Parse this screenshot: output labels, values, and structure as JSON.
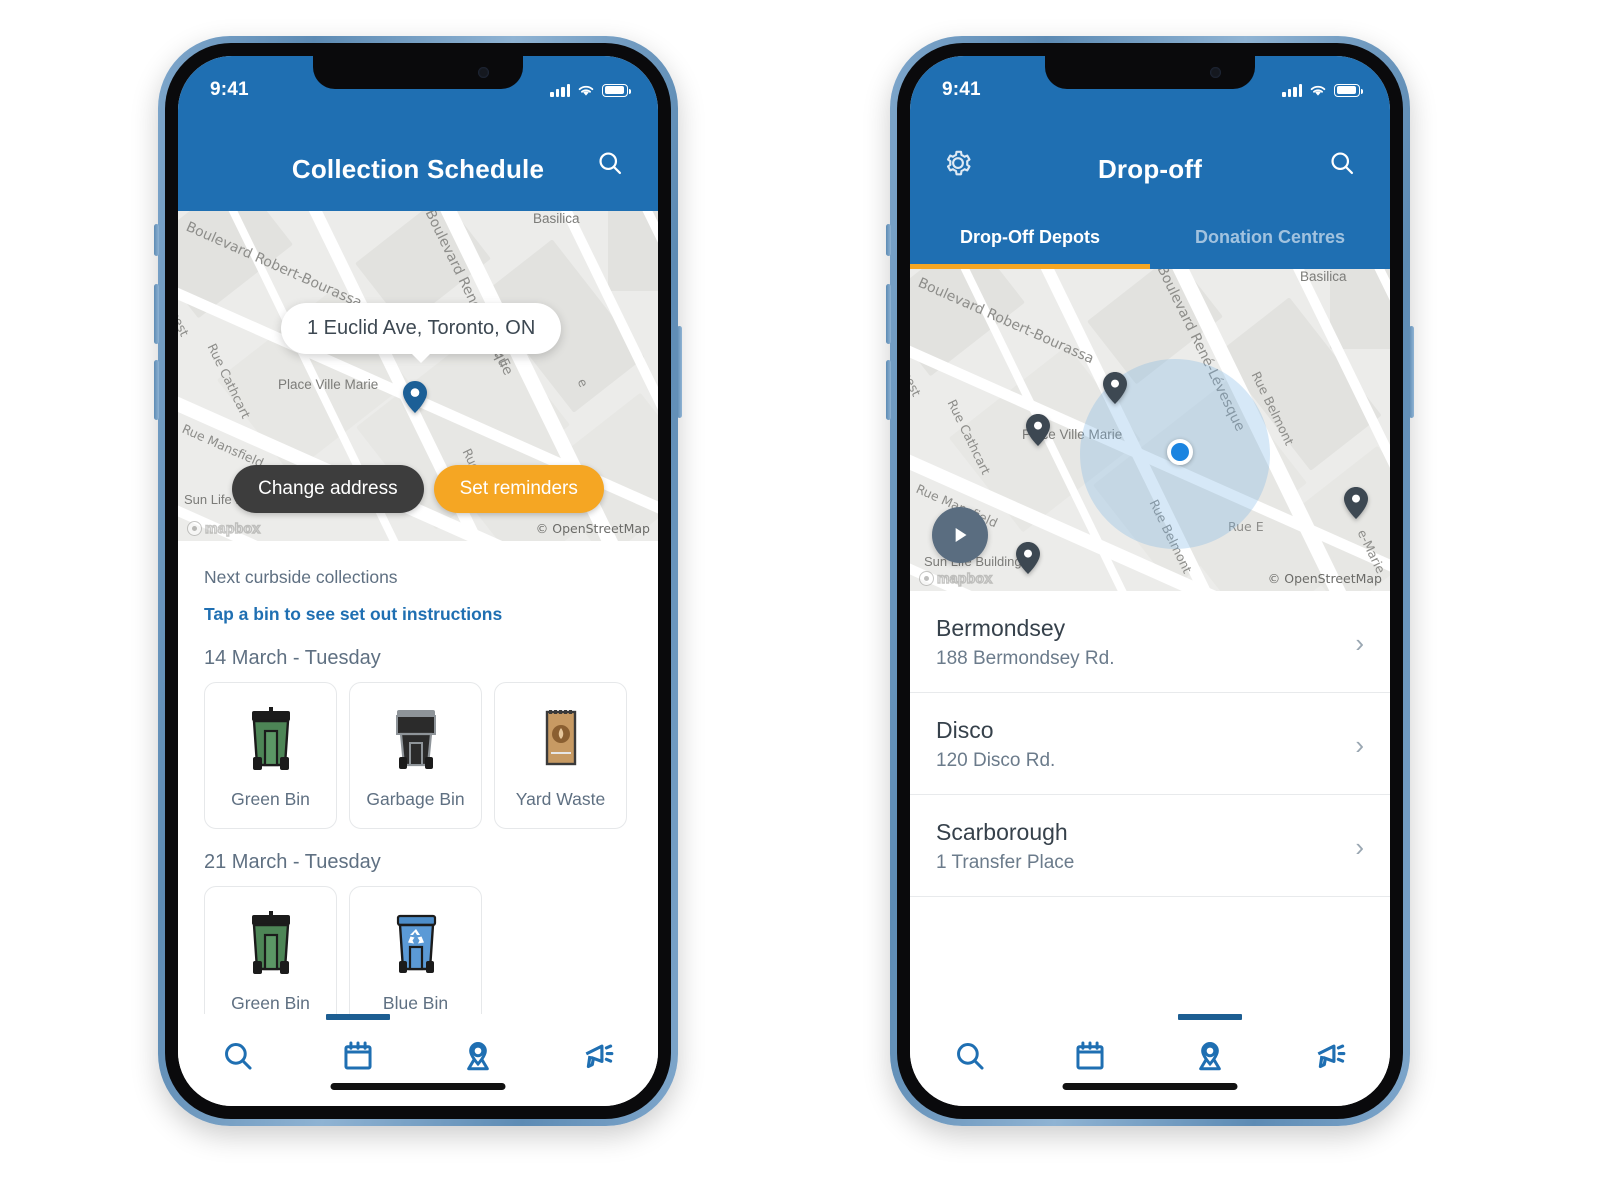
{
  "theme": {
    "header_blue": "#1f6fb2",
    "accent_orange": "#f5a623",
    "nav_blue": "#1f6fb2",
    "dark_pill": "#3d3d3d",
    "text_slate": "#5f7082"
  },
  "phone_left": {
    "status": {
      "time": "9:41",
      "signal_icon": "cellular-signal-icon",
      "wifi_icon": "wifi-icon",
      "battery_icon": "battery-icon"
    },
    "header": {
      "title": "Collection Schedule",
      "search_icon": "search-icon"
    },
    "map": {
      "address_bubble": "1 Euclid Ave, Toronto, ON",
      "place_labels": [
        "Place Ville Marie",
        "Sun Life Building",
        "Basilica"
      ],
      "street_labels": [
        "Boulevard Robert-Bourassa",
        "Boulevard René-Lévesque",
        "Rue Cathcart",
        "Rue Mansfield",
        "Ouest",
        "Rue E"
      ],
      "buttons": {
        "change_address": "Change address",
        "set_reminders": "Set reminders"
      },
      "attribution": "© OpenStreetMap",
      "logo": "mapbox"
    },
    "schedule": {
      "section_label": "Next curbside collections",
      "hint_link": "Tap a bin to see set out instructions",
      "days": [
        {
          "date": "14 March - Tuesday",
          "bins": [
            {
              "label": "Green Bin",
              "icon": "green-bin-icon"
            },
            {
              "label": "Garbage Bin",
              "icon": "garbage-bin-icon"
            },
            {
              "label": "Yard Waste",
              "icon": "yard-waste-bag-icon"
            }
          ]
        },
        {
          "date": "21 March - Tuesday",
          "bins": [
            {
              "label": "Green Bin",
              "icon": "green-bin-icon"
            },
            {
              "label": "Blue Bin",
              "icon": "blue-recycling-bin-icon"
            }
          ]
        }
      ]
    },
    "tabbar": {
      "active_index": 1,
      "items": [
        {
          "name": "search",
          "icon": "search-icon"
        },
        {
          "name": "schedule",
          "icon": "calendar-icon"
        },
        {
          "name": "drop-off",
          "icon": "map-pin-icon"
        },
        {
          "name": "alerts",
          "icon": "megaphone-icon"
        }
      ]
    }
  },
  "phone_right": {
    "status": {
      "time": "9:41",
      "signal_icon": "cellular-signal-icon",
      "wifi_icon": "wifi-icon",
      "battery_icon": "battery-icon"
    },
    "header": {
      "title": "Drop-off",
      "settings_icon": "gear-icon",
      "search_icon": "search-icon"
    },
    "tabs": {
      "active_index": 0,
      "items": [
        {
          "label": "Drop-Off Depots"
        },
        {
          "label": "Donation Centres"
        }
      ]
    },
    "map": {
      "place_labels": [
        "Place Ville Marie",
        "Sun Life Building",
        "Basilica"
      ],
      "street_labels": [
        "Boulevard Robert-Bourassa",
        "Boulevard René-Lévesque",
        "Rue Cathcart",
        "Rue Mansfield",
        "Rue Belmont",
        "Rue E",
        "Ouest",
        "Rue Belmont",
        "e-Marie"
      ],
      "locate_button_icon": "navigate-arrow-icon",
      "user_location_icon": "user-location-dot",
      "marker_count": 4,
      "attribution": "© OpenStreetMap",
      "logo": "mapbox"
    },
    "depots": [
      {
        "name": "Bermondsey",
        "address": "188 Bermondsey Rd.",
        "chevron": "›"
      },
      {
        "name": "Disco",
        "address": "120 Disco Rd.",
        "chevron": "›"
      },
      {
        "name": "Scarborough",
        "address": "1 Transfer Place",
        "chevron": "›"
      }
    ],
    "tabbar": {
      "active_index": 2,
      "items": [
        {
          "name": "search",
          "icon": "search-icon"
        },
        {
          "name": "schedule",
          "icon": "calendar-icon"
        },
        {
          "name": "drop-off",
          "icon": "map-pin-icon"
        },
        {
          "name": "alerts",
          "icon": "megaphone-icon"
        }
      ]
    }
  }
}
